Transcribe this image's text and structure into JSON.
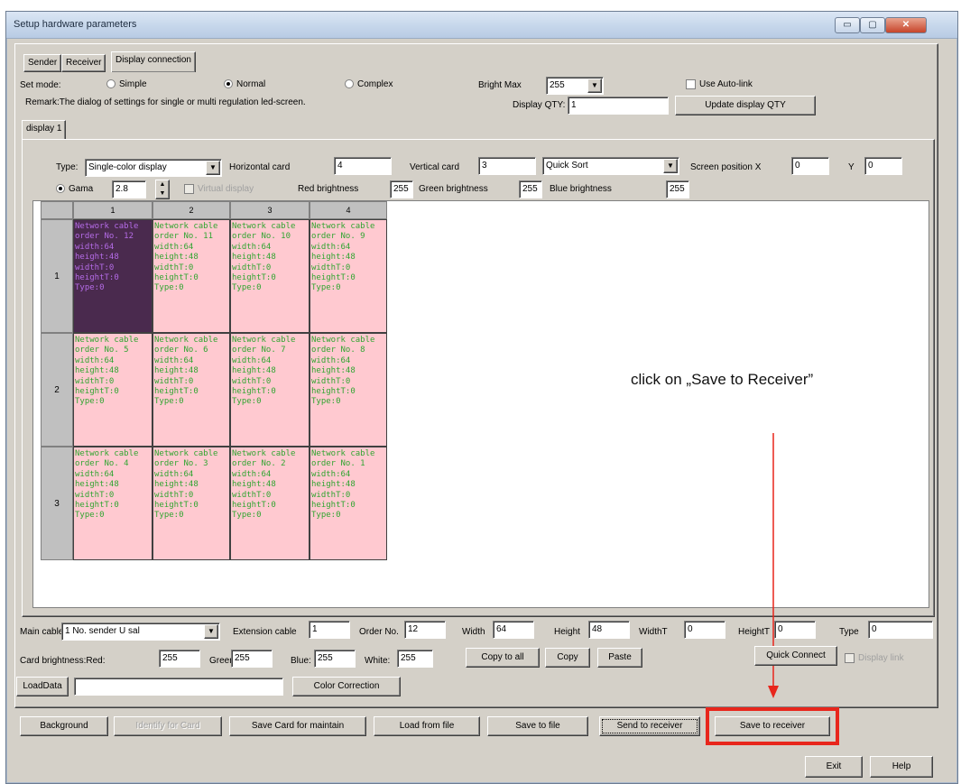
{
  "window": {
    "title": "Setup hardware parameters"
  },
  "title_buttons": {
    "minimize": "▭",
    "maximize": "▢",
    "close": "✕"
  },
  "tabs": [
    "Sender",
    "Receiver",
    "Display connection"
  ],
  "set_mode": {
    "label": "Set mode:",
    "options": [
      "Simple",
      "Normal",
      "Complex"
    ],
    "selected": "Normal"
  },
  "bright_max": {
    "label": "Bright Max",
    "value": "255"
  },
  "use_autolink": {
    "label": "Use Auto-link"
  },
  "remark": "Remark:The dialog of settings for single or multi  regulation led-screen.",
  "display_qty": {
    "label": "Display QTY:",
    "value": "1",
    "update_button": "Update display QTY"
  },
  "display_tab": "display 1",
  "type": {
    "label": "Type:",
    "value": "Single-color display"
  },
  "horizontal_card": {
    "label": "Horizontal card",
    "value": "4"
  },
  "vertical_card": {
    "label": "Vertical card",
    "value": "3"
  },
  "sort": {
    "value": "Quick Sort"
  },
  "screen_position": {
    "x_label": "Screen position X",
    "x_value": "0",
    "y_label": "Y",
    "y_value": "0"
  },
  "gama": {
    "label": "Gama",
    "value": "2.8"
  },
  "virtual_display": {
    "label": "Virtual display"
  },
  "red_brightness": {
    "label": "Red brightness",
    "value": "255"
  },
  "green_brightness": {
    "label": "Green brightness",
    "value": "255"
  },
  "blue_brightness": {
    "label": "Blue brightness",
    "value": "255"
  },
  "grid": {
    "columns": [
      "1",
      "2",
      "3",
      "4"
    ],
    "rows": [
      {
        "label": "1",
        "cells": [
          {
            "order": "order No. 12",
            "selected": true
          },
          {
            "order": "order No. 11",
            "selected": false
          },
          {
            "order": "order No. 10",
            "selected": false
          },
          {
            "order": "order No. 9",
            "selected": false
          }
        ]
      },
      {
        "label": "2",
        "cells": [
          {
            "order": "order No. 5",
            "selected": false
          },
          {
            "order": "order No. 6",
            "selected": false
          },
          {
            "order": "order No. 7",
            "selected": false
          },
          {
            "order": "order No. 8",
            "selected": false
          }
        ]
      },
      {
        "label": "3",
        "cells": [
          {
            "order": "order No. 4",
            "selected": false
          },
          {
            "order": "order No. 3",
            "selected": false
          },
          {
            "order": "order No. 2",
            "selected": false
          },
          {
            "order": "order No. 1",
            "selected": false
          }
        ]
      }
    ],
    "cell_lines": [
      "Network cable",
      "width:64",
      "height:48",
      "widthT:0",
      "heightT:0",
      "Type:0"
    ]
  },
  "annotation": "click on „Save to Receiver”",
  "bottom": {
    "main_cable": {
      "label": "Main cable",
      "value": "1 No. sender U sal"
    },
    "extension_cable": {
      "label": "Extension cable",
      "value": "1"
    },
    "order_no": {
      "label": "Order No.",
      "value": "12"
    },
    "width": {
      "label": "Width",
      "value": "64"
    },
    "height": {
      "label": "Height",
      "value": "48"
    },
    "widthT": {
      "label": "WidthT",
      "value": "0"
    },
    "heightT": {
      "label": "HeightT",
      "value": "0"
    },
    "type": {
      "label": "Type",
      "value": "0"
    },
    "card_brightness_red": {
      "label": "Card brightness:Red:",
      "value": "255"
    },
    "green": {
      "label": "Green:",
      "value": "255"
    },
    "blue": {
      "label": "Blue:",
      "value": "255"
    },
    "white": {
      "label": "White:",
      "value": "255"
    },
    "copy_to_all": "Copy to all",
    "copy": "Copy",
    "paste": "Paste",
    "quick_connect": "Quick Connect",
    "display_link": "Display link",
    "load_data": "LoadData",
    "load_data_value": "",
    "color_correction": "Color Correction"
  },
  "actions": {
    "background": "Background",
    "identify_for_card": "Identify for Card",
    "save_card_for_maintain": "Save Card for maintain",
    "load_from_file": "Load from file",
    "save_to_file": "Save to file",
    "send_to_receiver": "Send to receiver",
    "save_to_receiver": "Save to receiver"
  },
  "footer": {
    "exit": "Exit",
    "help": "Help"
  },
  "colors": {
    "highlight": "#e8261c",
    "cell_bg": "#ffc9d0",
    "cell_text": "#31a531",
    "selected_cell_bg": "#4a2a4e",
    "selected_cell_text": "#b46be6"
  }
}
